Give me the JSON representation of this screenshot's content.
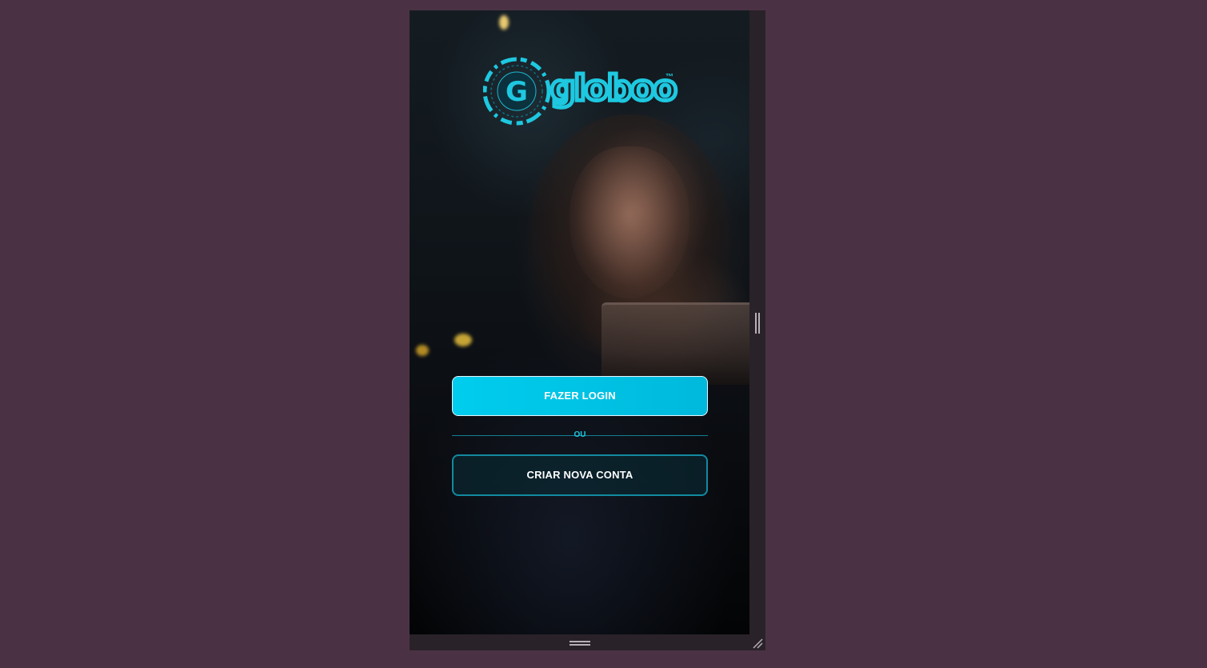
{
  "app": {
    "brand": "globoo",
    "brand_mark": "G",
    "trademark": "™"
  },
  "auth": {
    "login_label": "FAZER LOGIN",
    "divider_label": "OU",
    "signup_label": "CRIAR NOVA CONTA"
  },
  "icons": {
    "logo": "globoo-g-logo-icon",
    "vertical_resize": "vertical-resize-handle-icon",
    "horizontal_resize": "horizontal-resize-handle-icon",
    "corner_resize": "corner-resize-grip-icon"
  },
  "colors": {
    "page_background": "#4a3244",
    "frame": "#2a2229",
    "accent": "#1ec8e0",
    "login_button": "#00c6e8",
    "signup_border": "#128aa1"
  }
}
